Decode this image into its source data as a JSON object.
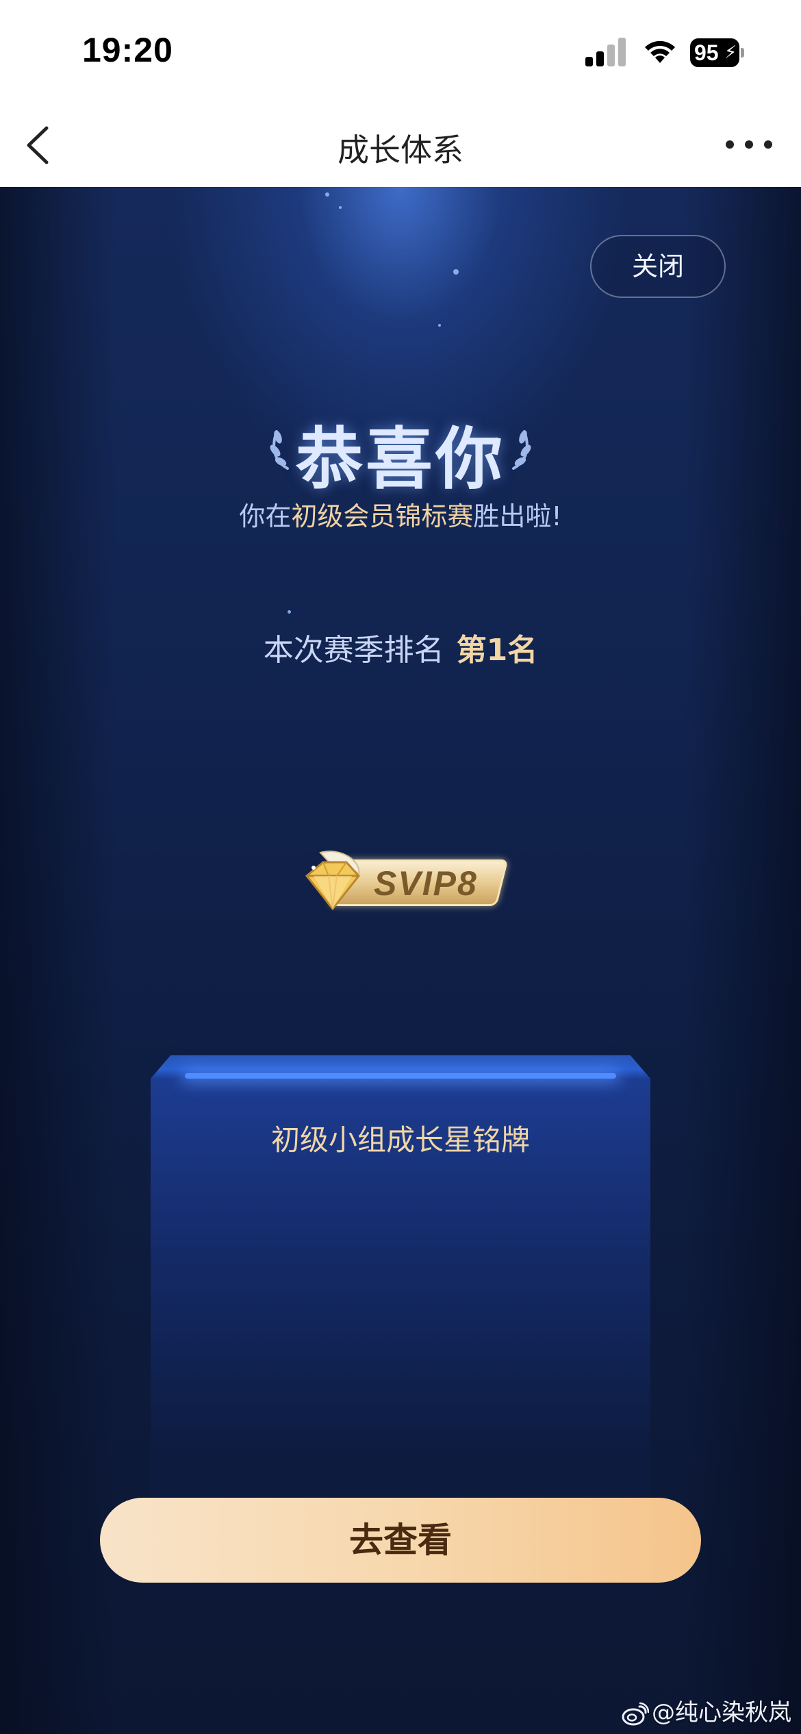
{
  "status_bar": {
    "time": "19:20",
    "battery_level": "95"
  },
  "nav": {
    "title": "成长体系"
  },
  "modal": {
    "close_label": "关闭",
    "title": "恭喜你",
    "subtitle_prefix": "你在",
    "subtitle_highlight": "初级会员锦标赛",
    "subtitle_suffix": "胜出啦!",
    "rank_label": "本次赛季排名",
    "rank_value": "第1名",
    "badge_text": "SVIP8",
    "podium_label": "初级小组成长星铭牌",
    "view_button_label": "去查看"
  },
  "watermark": {
    "text": "@纯心染秋岚"
  },
  "colors": {
    "accent_gold": "#f3d6a5",
    "button_gradient_start": "#f8e3c8",
    "button_gradient_end": "#f5c48b",
    "stage_background": "#0d1630"
  }
}
